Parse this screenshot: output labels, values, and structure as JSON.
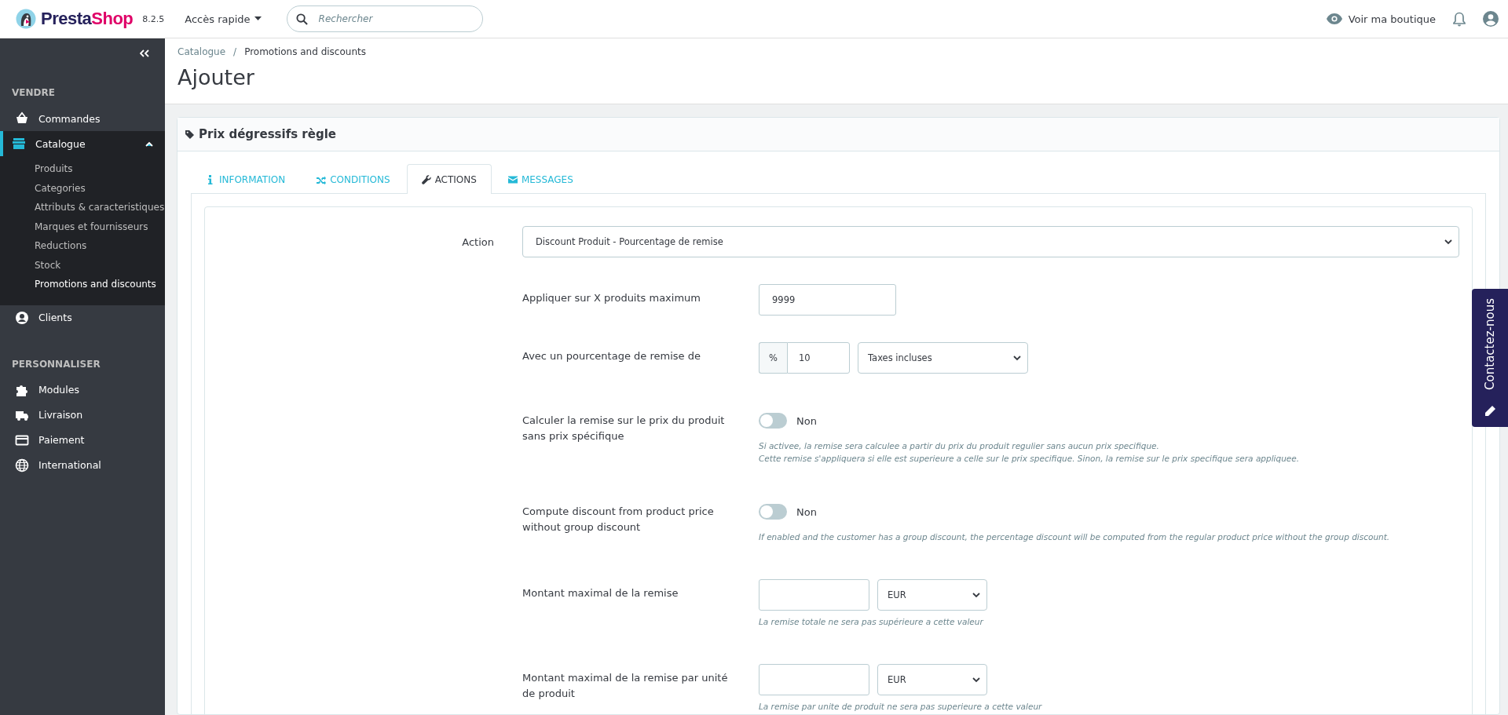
{
  "topbar": {
    "logo_parts": [
      "Presta",
      "Shop"
    ],
    "version": "8.2.5",
    "quick_access": "Accès rapide",
    "search": {
      "placeholder": "Rechercher"
    },
    "view_shop": "Voir ma boutique"
  },
  "sidebar": {
    "sections": [
      {
        "title": "VENDRE",
        "items": [
          {
            "label": "Commandes",
            "selected": false
          },
          {
            "label": "Catalogue",
            "selected": true,
            "expanded": true,
            "children": [
              {
                "label": "Produits",
                "selected": false
              },
              {
                "label": "Categories",
                "selected": false
              },
              {
                "label": "Attributs & caracteristiques",
                "selected": false
              },
              {
                "label": "Marques et fournisseurs",
                "selected": false
              },
              {
                "label": "Reductions",
                "selected": false
              },
              {
                "label": "Stock",
                "selected": false
              },
              {
                "label": "Promotions and discounts",
                "selected": true
              }
            ]
          },
          {
            "label": "Clients",
            "selected": false
          }
        ]
      },
      {
        "title": "PERSONNALISER",
        "items": [
          {
            "label": "Modules",
            "selected": false
          },
          {
            "label": "Livraison",
            "selected": false
          },
          {
            "label": "Paiement",
            "selected": false
          },
          {
            "label": "International",
            "selected": false
          }
        ]
      }
    ]
  },
  "breadcrumb": [
    "Catalogue",
    "Promotions and discounts"
  ],
  "breadcrumb_separator": "/",
  "page_title": "Ajouter",
  "panel": {
    "title": "Prix dégressifs règle",
    "tabs": [
      {
        "label": "INFORMATION",
        "selected": false
      },
      {
        "label": "CONDITIONS",
        "selected": false
      },
      {
        "label": "ACTIONS",
        "selected": true
      },
      {
        "label": "MESSAGES",
        "selected": false
      }
    ],
    "action": {
      "label": "Action",
      "value": "Discount Produit - Pourcentage de remise"
    },
    "rows": [
      {
        "kind": "text",
        "label": "Appliquer sur X produits maximum",
        "value": "9999"
      },
      {
        "kind": "percent",
        "label": "Avec un pourcentage de remise de",
        "prefix": "%",
        "value": "10",
        "select": "Taxes incluses"
      },
      {
        "kind": "toggle",
        "label": "Calculer la remise sur le prix du produit sans prix spécifique",
        "on": false,
        "state_label": "Non",
        "help": [
          "Si activee, la remise sera calculee a partir du prix du produit regulier sans aucun prix specifique.",
          "Cette remise s'appliquera si elle est superieure a celle sur le prix specifique. Sinon, la remise sur le prix specifique sera appliquee."
        ]
      },
      {
        "kind": "toggle",
        "label": "Compute discount from product price without group discount",
        "on": false,
        "state_label": "Non",
        "help": [
          "If enabled and the customer has a group discount, the percentage discount will be computed from the regular product price without the group discount."
        ]
      },
      {
        "kind": "amount",
        "label": "Montant maximal de la remise",
        "select": "EUR",
        "help": [
          "La remise totale ne sera pas supérieure a cette valeur"
        ]
      },
      {
        "kind": "amount",
        "label": "Montant maximal de la remise par unité de produit",
        "select": "EUR",
        "help": [
          "La remise par unite de produit ne sera pas superieure a cette valeur"
        ]
      }
    ]
  },
  "contact_tab": "Contactez-nous"
}
